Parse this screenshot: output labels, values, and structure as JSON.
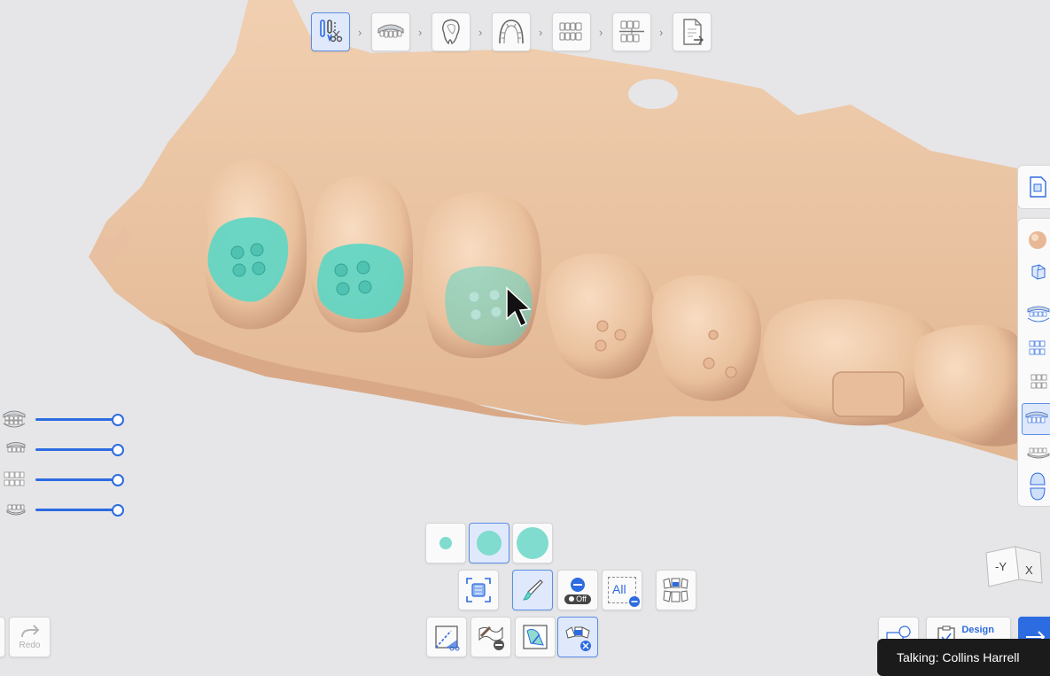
{
  "workflow_steps": [
    {
      "name": "segmentation-step",
      "icon": "tooth-cut-icon",
      "active": true
    },
    {
      "name": "arch-step",
      "icon": "full-arch-icon",
      "active": false
    },
    {
      "name": "tooth-step",
      "icon": "single-tooth-icon",
      "active": false
    },
    {
      "name": "bracket-step",
      "icon": "arch-outline-icon",
      "active": false
    },
    {
      "name": "occlusion-step",
      "icon": "bite-icon",
      "active": false
    },
    {
      "name": "setup-step",
      "icon": "alignment-icon",
      "active": false
    },
    {
      "name": "export-step",
      "icon": "export-document-icon",
      "active": false
    }
  ],
  "visibility_sliders": [
    {
      "icon": "upper-lower-jaw-icon",
      "value": 1.0
    },
    {
      "icon": "upper-teeth-icon",
      "value": 1.0
    },
    {
      "icon": "both-arches-icon",
      "value": 1.0
    },
    {
      "icon": "lower-teeth-icon",
      "value": 1.0
    }
  ],
  "brush_sizes": [
    "small",
    "medium",
    "large"
  ],
  "brush_selected": "medium",
  "tools": {
    "off_label": "Off",
    "all_label": "All"
  },
  "bottom_left": {
    "redo_label": "Redo"
  },
  "design_label": "Design",
  "view_cube": {
    "face1": "-Y",
    "face2": "X"
  },
  "talking_label": "Talking: Collins Harrell",
  "colors": {
    "accent": "#2d6be0",
    "selection": "#5fd6c4",
    "model": "#ecc6a4"
  }
}
